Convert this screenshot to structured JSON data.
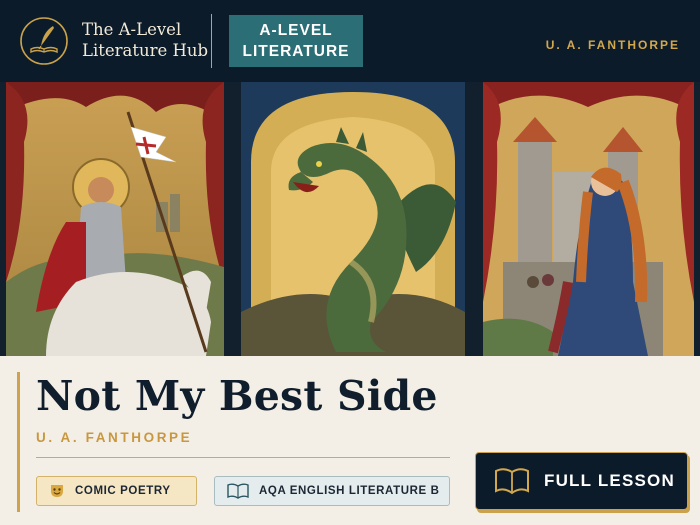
{
  "header": {
    "logo_line1": "The A-Level",
    "logo_line2": "Literature Hub",
    "badge_line1": "A-LEVEL",
    "badge_line2": "LITERATURE",
    "author": "U. A. FANTHORPE"
  },
  "main": {
    "title": "Not My Best Side",
    "author": "U. A. FANTHORPE",
    "tags": [
      {
        "label": "COMIC POETRY",
        "icon": "theatre-mask-icon"
      },
      {
        "label": "AQA ENGLISH LITERATURE B",
        "icon": "open-book-icon"
      }
    ],
    "lesson_button": {
      "label": "FULL LESSON",
      "icon": "open-book-icon"
    }
  },
  "panels": [
    {
      "subject": "knight-on-horse-panel"
    },
    {
      "subject": "dragon-panel"
    },
    {
      "subject": "princess-castle-panel"
    }
  ],
  "colors": {
    "navy": "#0c1b2a",
    "gold": "#c9a24b",
    "teal": "#2b6e75",
    "cream": "#f4efe6"
  }
}
